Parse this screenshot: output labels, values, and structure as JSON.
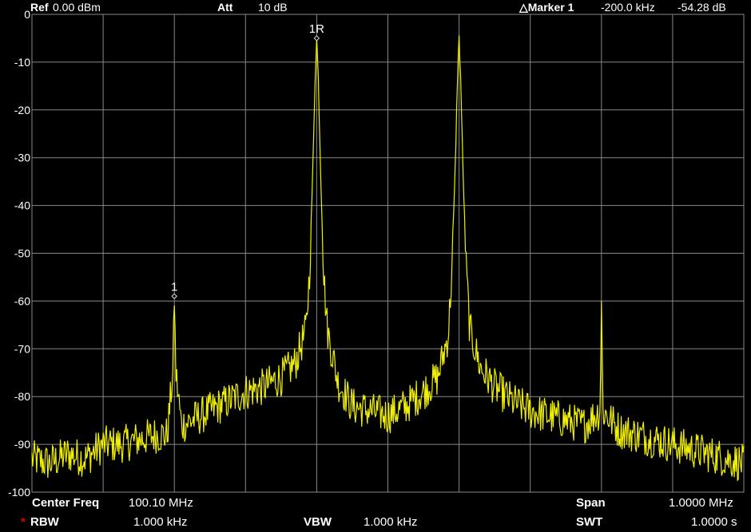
{
  "header": {
    "ref_label": "Ref",
    "ref_value": "0.00 dBm",
    "att_label": "Att",
    "att_value": "10 dB",
    "marker_label": "△Marker 1",
    "marker_freq": "-200.0 kHz",
    "marker_level": "-54.28 dB"
  },
  "footer": {
    "center_label": "Center Freq",
    "center_value": "100.10 MHz",
    "span_label": "Span",
    "span_value": "1.0000 MHz",
    "rbw_star": "*",
    "rbw_label": "RBW",
    "rbw_value": "1.000 kHz",
    "vbw_label": "VBW",
    "vbw_value": "1.000 kHz",
    "swt_label": "SWT",
    "swt_value": "1.0000 s"
  },
  "colors": {
    "trace": "#f0f000",
    "grid": "#888888",
    "background": "#000000",
    "text": "#ffffff",
    "star": "#e00000"
  },
  "chart_data": {
    "type": "line",
    "xlim": [
      99.6,
      100.6
    ],
    "ylim": [
      -100,
      0
    ],
    "y_ticks": [
      0,
      -10,
      -20,
      -30,
      -40,
      -50,
      -60,
      -70,
      -80,
      -90,
      -100
    ],
    "y_tick_labels": [
      "0",
      "-10",
      "-20",
      "-30",
      "-40",
      "-50",
      "-60",
      "-70",
      "-80",
      "-90",
      "-100"
    ],
    "x_divisions": 10,
    "grid": true,
    "series": [
      {
        "x": [
          99.6,
          99.625,
          99.65,
          99.675,
          99.7,
          99.725,
          99.75,
          99.775,
          99.79,
          99.798,
          99.8,
          99.802,
          99.81,
          99.825,
          99.85,
          99.875,
          99.9,
          99.925,
          99.95,
          99.97,
          99.985,
          99.99,
          99.995,
          99.998,
          100.0,
          100.002,
          100.005,
          100.01,
          100.015,
          100.03,
          100.05,
          100.075,
          100.1,
          100.125,
          100.15,
          100.17,
          100.185,
          100.19,
          100.195,
          100.198,
          100.2,
          100.202,
          100.205,
          100.21,
          100.215,
          100.23,
          100.25,
          100.275,
          100.3,
          100.325,
          100.35,
          100.375,
          100.398,
          100.4,
          100.402,
          100.425,
          100.45,
          100.475,
          100.5,
          100.525,
          100.55,
          100.575,
          100.6
        ],
        "y": [
          -93,
          -94,
          -92,
          -93,
          -90,
          -90,
          -89,
          -88,
          -88,
          -75,
          -59,
          -75,
          -86,
          -85,
          -83,
          -81,
          -79,
          -78,
          -76,
          -73,
          -66,
          -54,
          -30,
          -12,
          -5,
          -12,
          -30,
          -55,
          -66,
          -77,
          -82,
          -83,
          -84,
          -82,
          -79,
          -76,
          -67,
          -53,
          -30,
          -12,
          -5,
          -12,
          -30,
          -53,
          -66,
          -74,
          -78,
          -81,
          -83,
          -84,
          -85,
          -86,
          -83,
          -60,
          -83,
          -87,
          -88,
          -89,
          -90,
          -91,
          -92,
          -93,
          -94
        ]
      }
    ],
    "markers": [
      {
        "label": "1",
        "x": 99.8,
        "y": -59
      },
      {
        "label": "1R",
        "x": 100.0,
        "y": -5
      }
    ]
  }
}
